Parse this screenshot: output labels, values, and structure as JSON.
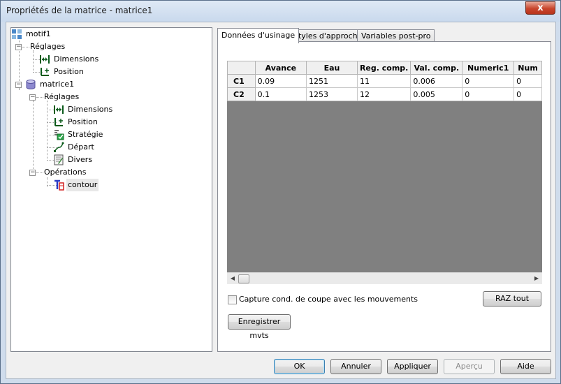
{
  "window": {
    "title": "Propriétés de la matrice - matrice1",
    "close_glyph": "x"
  },
  "tree": {
    "nodes": [
      {
        "label": "motif1",
        "icon": "pattern-grid-icon",
        "expanded": true
      },
      {
        "label": "Réglages",
        "icon": "",
        "expanded": true
      },
      {
        "label": "Dimensions",
        "icon": "dimensions-icon"
      },
      {
        "label": "Position",
        "icon": "position-icon"
      },
      {
        "label": "matrice1",
        "icon": "database-cylinder-icon",
        "expanded": true
      },
      {
        "label": "Réglages",
        "icon": "",
        "expanded": true
      },
      {
        "label": "Dimensions",
        "icon": "dimensions-icon"
      },
      {
        "label": "Position",
        "icon": "position-icon"
      },
      {
        "label": "Stratégie",
        "icon": "strategy-icon"
      },
      {
        "label": "Départ",
        "icon": "start-path-icon"
      },
      {
        "label": "Divers",
        "icon": "notepad-icon"
      },
      {
        "label": "Opérations",
        "icon": "",
        "expanded": true
      },
      {
        "label": "contour",
        "icon": "contour-tool-icon",
        "selected": true
      }
    ]
  },
  "tabs": [
    {
      "label": "Données d'usinage",
      "active": true
    },
    {
      "label": "Styles d'approche",
      "active": false
    },
    {
      "label": "Variables post-pro",
      "active": false
    }
  ],
  "grid": {
    "columns": [
      "Avance",
      "Eau",
      "Reg. comp.",
      "Val. comp.",
      "Numeric1",
      "Num"
    ],
    "rows": [
      {
        "header": "C1",
        "cells": [
          "0.09",
          "1251",
          "11",
          "0.006",
          "0",
          "0"
        ]
      },
      {
        "header": "C2",
        "cells": [
          "0.1",
          "1253",
          "12",
          "0.005",
          "0",
          "0"
        ]
      }
    ]
  },
  "options": {
    "capture_label": "Capture cond. de coupe avec les mouvements",
    "capture_checked": false,
    "reset_label": "RAZ tout",
    "save_moves_label": "Enregistrer mvts"
  },
  "footer": {
    "ok": "OK",
    "cancel": "Annuler",
    "apply": "Appliquer",
    "preview": "Aperçu",
    "help": "Aide"
  },
  "colors": {
    "grid_background": "#808080",
    "title_bar": "#cfdcec",
    "close_button": "#c8452c"
  }
}
